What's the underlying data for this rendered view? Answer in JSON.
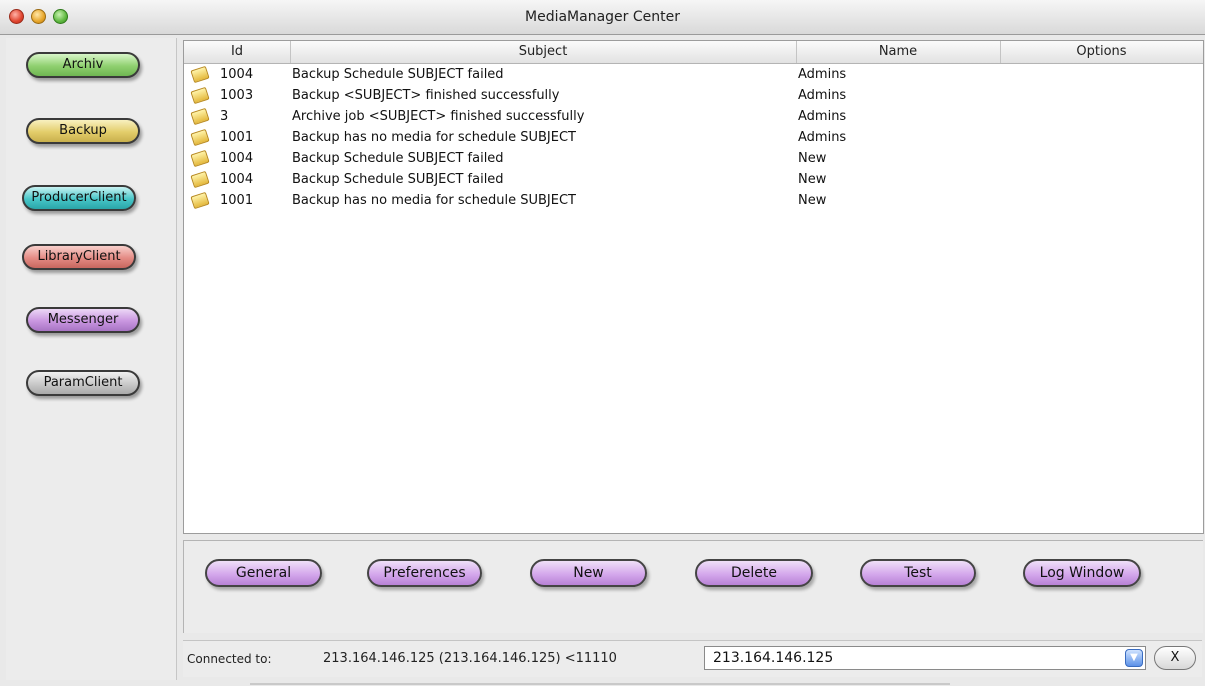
{
  "window": {
    "title": "MediaManager Center"
  },
  "sidebar": {
    "items": [
      {
        "label": "Archiv"
      },
      {
        "label": "Backup"
      },
      {
        "label": "ProducerClient"
      },
      {
        "label": "LibraryClient"
      },
      {
        "label": "Messenger"
      },
      {
        "label": "ParamClient"
      }
    ]
  },
  "table": {
    "columns": [
      "Id",
      "Subject",
      "Name",
      "Options"
    ],
    "rows": [
      {
        "id": "1004",
        "subject": "Backup Schedule SUBJECT failed",
        "name": "Admins",
        "options": ""
      },
      {
        "id": "1003",
        "subject": "Backup <SUBJECT> finished successfully",
        "name": "Admins",
        "options": ""
      },
      {
        "id": "3",
        "subject": "Archive job <SUBJECT> finished successfully",
        "name": "Admins",
        "options": ""
      },
      {
        "id": "1001",
        "subject": "Backup has no media for schedule SUBJECT",
        "name": "Admins",
        "options": ""
      },
      {
        "id": "1004",
        "subject": "Backup Schedule SUBJECT failed",
        "name": "New",
        "options": ""
      },
      {
        "id": "1004",
        "subject": "Backup Schedule SUBJECT failed",
        "name": "New",
        "options": ""
      },
      {
        "id": "1001",
        "subject": "Backup has no media for schedule SUBJECT",
        "name": "New",
        "options": ""
      }
    ]
  },
  "actions": {
    "general": "General",
    "preferences": "Preferences",
    "new": "New",
    "delete": "Delete",
    "test": "Test",
    "log_window": "Log Window"
  },
  "status": {
    "connected_label": "Connected to:",
    "connected_text": "213.164.146.125 (213.164.146.125) <11110",
    "server_value": "213.164.146.125",
    "close_label": "X"
  }
}
